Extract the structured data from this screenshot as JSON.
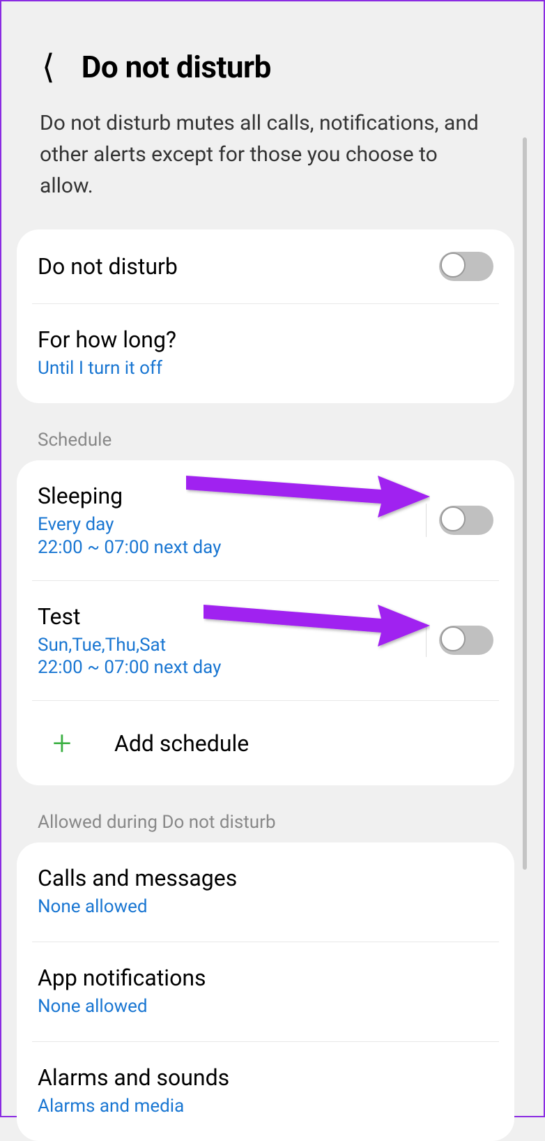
{
  "header": {
    "title": "Do not disturb"
  },
  "description": "Do not disturb mutes all calls, notifications, and other alerts except for those you choose to allow.",
  "main_toggle": {
    "label": "Do not disturb",
    "on": false
  },
  "how_long": {
    "label": "For how long?",
    "value": "Until I turn it off"
  },
  "sections": {
    "schedule": {
      "header": "Schedule",
      "items": [
        {
          "title": "Sleeping",
          "days": "Every day",
          "time": "22:00 ~ 07:00 next day",
          "on": false
        },
        {
          "title": "Test",
          "days": "Sun,Tue,Thu,Sat",
          "time": "22:00 ~ 07:00 next day",
          "on": false
        }
      ],
      "add_label": "Add schedule"
    },
    "allowed": {
      "header": "Allowed during Do not disturb",
      "items": [
        {
          "title": "Calls and messages",
          "value": "None allowed"
        },
        {
          "title": "App notifications",
          "value": "None allowed"
        },
        {
          "title": "Alarms and sounds",
          "value": "Alarms and media"
        }
      ]
    }
  }
}
